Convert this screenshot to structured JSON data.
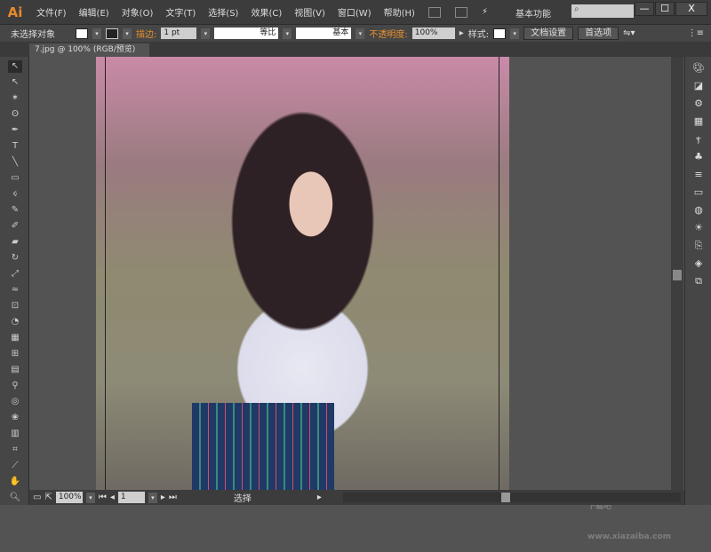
{
  "app": {
    "logo": "Ai"
  },
  "menu": [
    "文件(F)",
    "编辑(E)",
    "对象(O)",
    "文字(T)",
    "选择(S)",
    "效果(C)",
    "视图(V)",
    "窗口(W)",
    "帮助(H)"
  ],
  "workspace": "基本功能",
  "search_placeholder": "",
  "window_buttons": {
    "minimize": "—",
    "maximize": "☐",
    "close": "X"
  },
  "control": {
    "selection": "未选择对象",
    "stroke_label": "描边:",
    "stroke_value": "1 pt",
    "profile": "等比",
    "brush": "基本",
    "opacity_label": "不透明度:",
    "opacity_value": "100%",
    "style_label": "样式:",
    "doc_setup": "文档设置",
    "preferences": "首选项"
  },
  "document_tab": {
    "title": "7.jpg @ 100% (RGB/预览)",
    "close": "×"
  },
  "status": {
    "zoom": "100%",
    "artboard": "1",
    "tool": "选择"
  },
  "watermark": "下载吧 www.xiazaiba.com"
}
